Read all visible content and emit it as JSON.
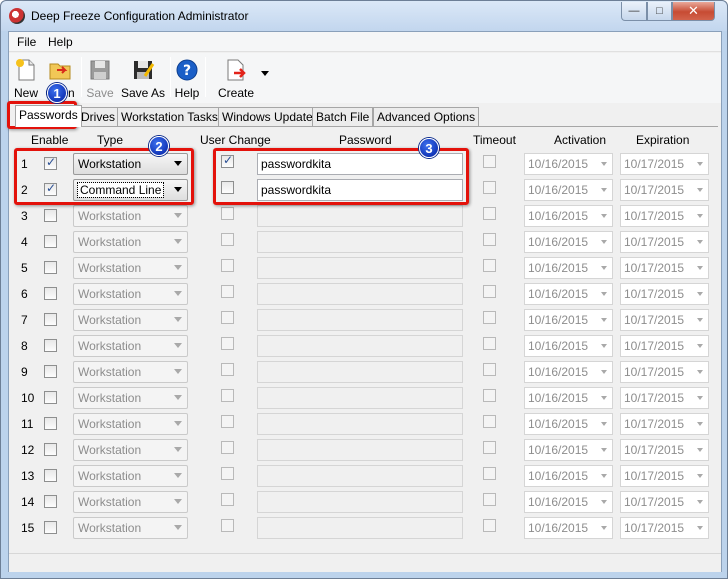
{
  "window": {
    "title": "Deep Freeze Configuration Administrator"
  },
  "menu": [
    "File",
    "Help"
  ],
  "toolbar": {
    "new": "New",
    "open": "Open",
    "save": "Save",
    "save_as": "Save As",
    "help": "Help",
    "create": "Create"
  },
  "tabs": [
    "Passwords",
    "Drives",
    "Workstation Tasks",
    "Windows Update",
    "Batch File",
    "Advanced Options"
  ],
  "headers": {
    "enable": "Enable",
    "type": "Type",
    "user_change": "User Change",
    "password": "Password",
    "timeout": "Timeout",
    "activation": "Activation",
    "expiration": "Expiration"
  },
  "rows": [
    {
      "num": "1",
      "enabled": true,
      "type": "Workstation",
      "user_change": true,
      "password": "passwordkita",
      "timeout": false,
      "activation": "10/16/2015",
      "expiration": "10/17/2015"
    },
    {
      "num": "2",
      "enabled": true,
      "type": "Command Line",
      "user_change": false,
      "password": "passwordkita",
      "timeout": false,
      "activation": "10/16/2015",
      "expiration": "10/17/2015"
    },
    {
      "num": "3",
      "enabled": false,
      "type": "Workstation",
      "user_change": false,
      "password": "",
      "timeout": false,
      "activation": "10/16/2015",
      "expiration": "10/17/2015"
    },
    {
      "num": "4",
      "enabled": false,
      "type": "Workstation",
      "user_change": false,
      "password": "",
      "timeout": false,
      "activation": "10/16/2015",
      "expiration": "10/17/2015"
    },
    {
      "num": "5",
      "enabled": false,
      "type": "Workstation",
      "user_change": false,
      "password": "",
      "timeout": false,
      "activation": "10/16/2015",
      "expiration": "10/17/2015"
    },
    {
      "num": "6",
      "enabled": false,
      "type": "Workstation",
      "user_change": false,
      "password": "",
      "timeout": false,
      "activation": "10/16/2015",
      "expiration": "10/17/2015"
    },
    {
      "num": "7",
      "enabled": false,
      "type": "Workstation",
      "user_change": false,
      "password": "",
      "timeout": false,
      "activation": "10/16/2015",
      "expiration": "10/17/2015"
    },
    {
      "num": "8",
      "enabled": false,
      "type": "Workstation",
      "user_change": false,
      "password": "",
      "timeout": false,
      "activation": "10/16/2015",
      "expiration": "10/17/2015"
    },
    {
      "num": "9",
      "enabled": false,
      "type": "Workstation",
      "user_change": false,
      "password": "",
      "timeout": false,
      "activation": "10/16/2015",
      "expiration": "10/17/2015"
    },
    {
      "num": "10",
      "enabled": false,
      "type": "Workstation",
      "user_change": false,
      "password": "",
      "timeout": false,
      "activation": "10/16/2015",
      "expiration": "10/17/2015"
    },
    {
      "num": "11",
      "enabled": false,
      "type": "Workstation",
      "user_change": false,
      "password": "",
      "timeout": false,
      "activation": "10/16/2015",
      "expiration": "10/17/2015"
    },
    {
      "num": "12",
      "enabled": false,
      "type": "Workstation",
      "user_change": false,
      "password": "",
      "timeout": false,
      "activation": "10/16/2015",
      "expiration": "10/17/2015"
    },
    {
      "num": "13",
      "enabled": false,
      "type": "Workstation",
      "user_change": false,
      "password": "",
      "timeout": false,
      "activation": "10/16/2015",
      "expiration": "10/17/2015"
    },
    {
      "num": "14",
      "enabled": false,
      "type": "Workstation",
      "user_change": false,
      "password": "",
      "timeout": false,
      "activation": "10/16/2015",
      "expiration": "10/17/2015"
    },
    {
      "num": "15",
      "enabled": false,
      "type": "Workstation",
      "user_change": false,
      "password": "",
      "timeout": false,
      "activation": "10/16/2015",
      "expiration": "10/17/2015"
    }
  ],
  "annotations": [
    "1",
    "2",
    "3"
  ],
  "colors": {
    "callout": "#e3120b",
    "badge": "#1a44d0",
    "check": "#2a4f94"
  }
}
